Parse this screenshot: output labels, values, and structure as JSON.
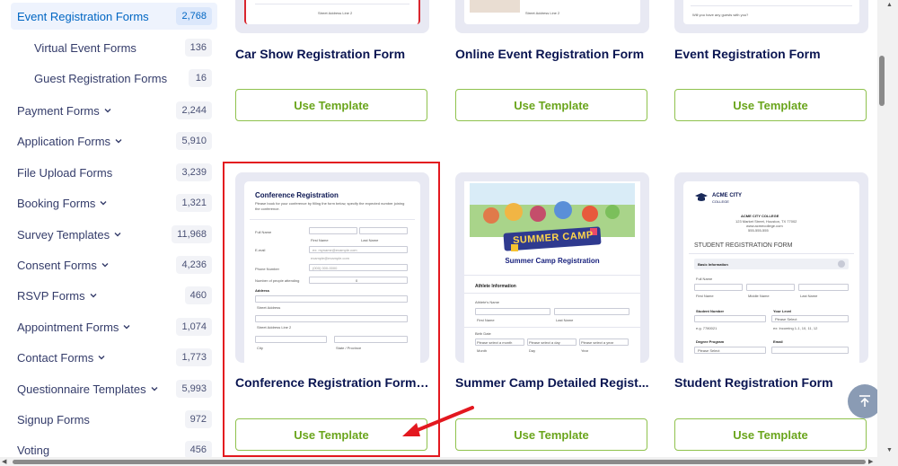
{
  "sidebar": {
    "items": [
      {
        "label": "Event Registration Forms",
        "count": "2,768",
        "active": true
      },
      {
        "label": "Virtual Event Forms",
        "count": "136"
      },
      {
        "label": "Guest Registration Forms",
        "count": "16"
      },
      {
        "label": "Payment Forms",
        "count": "2,244"
      },
      {
        "label": "Application Forms",
        "count": "5,910"
      },
      {
        "label": "File Upload Forms",
        "count": "3,239"
      },
      {
        "label": "Booking Forms",
        "count": "1,321"
      },
      {
        "label": "Survey Templates",
        "count": "11,968"
      },
      {
        "label": "Consent Forms",
        "count": "4,236"
      },
      {
        "label": "RSVP Forms",
        "count": "460"
      },
      {
        "label": "Appointment Forms",
        "count": "1,074"
      },
      {
        "label": "Contact Forms",
        "count": "1,773"
      },
      {
        "label": "Questionnaire Templates",
        "count": "5,993"
      },
      {
        "label": "Signup Forms",
        "count": "972"
      },
      {
        "label": "Voting",
        "count": "456"
      }
    ]
  },
  "cards": {
    "use_label": "Use Template",
    "row1": [
      {
        "title": "Car Show Registration Form",
        "thumb_text": "Street Address Line 2"
      },
      {
        "title": "Online Event Registration Form",
        "thumb_text": "Street Address Line 2"
      },
      {
        "title": "Event Registration Form",
        "thumb_text": "Will you have any guests with you?"
      }
    ],
    "row2": [
      {
        "title": "Conference Registration Form ..."
      },
      {
        "title": "Summer Camp Detailed Regist..."
      },
      {
        "title": "Student Registration Form"
      }
    ]
  },
  "conference_preview": {
    "title": "Conference Registration",
    "intro": "Please book for your conference by filling the form below, specify the expected number joining the conference.",
    "full_name": "Full Name",
    "first_name": "First Name",
    "last_name": "Last Name",
    "email": "E-mail",
    "email_placeholder": "ex: myname@example.com",
    "email_hint": "example@example.com",
    "phone": "Phone Number",
    "phone_placeholder": "(000) 000-0000",
    "people": "Number of people attending",
    "people_value": "0",
    "address": "Address",
    "street": "Street Address",
    "street2": "Street Address Line 2",
    "city": "City",
    "state": "State / Province"
  },
  "camp_preview": {
    "banner": "SUMMER CAMP",
    "title": "Summer Camp Registration",
    "section": "Athlete Information",
    "athlete_name": "Athlete's Name",
    "first_name": "First Name",
    "last_name": "Last Name",
    "birth_date": "Birth Date",
    "month": "Please select a month",
    "day": "Please select a day",
    "year": "Please select a year",
    "month_lbl": "Month",
    "day_lbl": "Day",
    "year_lbl": "Year"
  },
  "student_preview": {
    "college": "ACME CITY",
    "college_sub": "COLLEGE",
    "college_name": "ACME CITY COLLEGE",
    "college_addr": "123 Market Street, Houston, TX 77002",
    "college_web": "www.acmecollege.com",
    "college_phone": "555-555-555",
    "heading": "STUDENT REGISTRATION FORM",
    "section": "Basic Information",
    "full_name": "Full Name",
    "first": "First Name",
    "middle": "Middle Name",
    "last": "Last Name",
    "student_number": "Student Number",
    "your_level": "Your Level",
    "level_select": "Please Select",
    "eg": "e.g. 7780021",
    "eg2": "ex: Incoming 1-1, 10, 11, 12",
    "degree": "Degree Program",
    "email": "Email",
    "degree_select": "Please Select"
  },
  "colors": {
    "accent_green": "#6aa51c",
    "highlight_red": "#e3181f",
    "active_blue": "#0066c3"
  }
}
